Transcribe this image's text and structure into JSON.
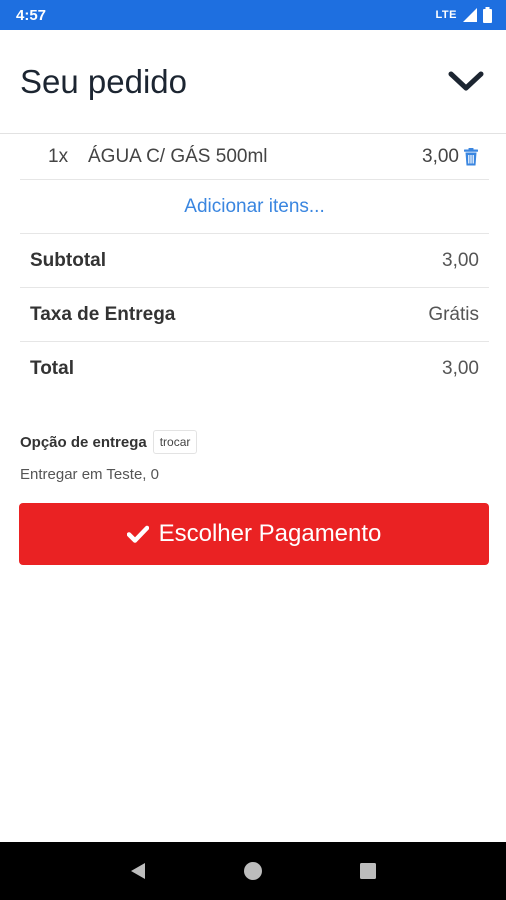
{
  "status_bar": {
    "time": "4:57",
    "network": "LTE"
  },
  "header": {
    "title": "Seu pedido",
    "collapse_icon": "chevron-down-icon"
  },
  "items": [
    {
      "qty": "1x",
      "name": "ÁGUA C/ GÁS 500ml",
      "price": "3,00"
    }
  ],
  "add_items_label": "Adicionar itens...",
  "summary": {
    "subtotal_label": "Subtotal",
    "subtotal_value": "3,00",
    "fee_label": "Taxa de Entrega",
    "fee_value": "Grátis",
    "total_label": "Total",
    "total_value": "3,00"
  },
  "delivery": {
    "label": "Opção de entrega",
    "change_label": "trocar",
    "address": "Entregar em Teste, 0"
  },
  "payment_button": {
    "label": "Escolher Pagamento",
    "icon": "check-icon"
  },
  "colors": {
    "status_bar": "#1e6fe0",
    "accent_link": "#3a86e0",
    "primary_button": "#ea2223"
  }
}
